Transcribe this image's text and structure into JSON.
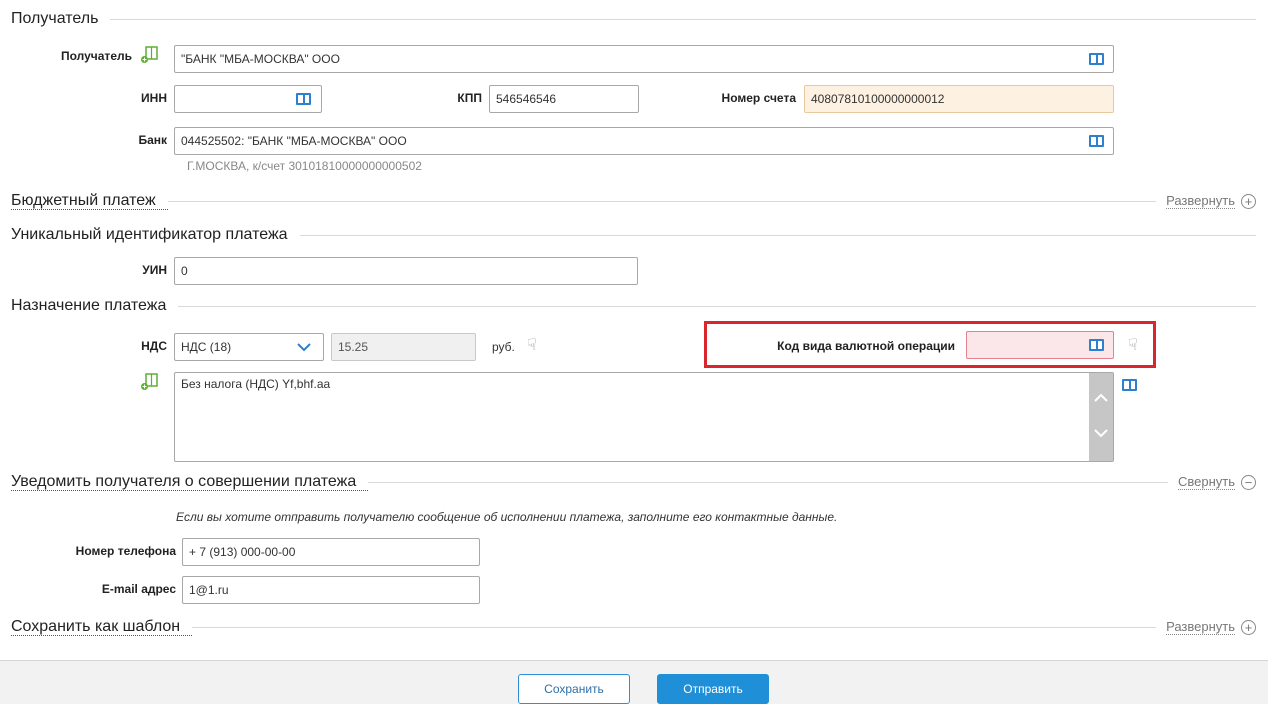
{
  "colors": {
    "accent": "#1f8fd8",
    "highlight_box": "#d9262c",
    "account_field_bg": "#fdf1e2",
    "error_field_bg": "#fbe6ea",
    "contact_icon": "#5cb030"
  },
  "sections": {
    "recipient": {
      "title": "Получатель",
      "recipient_label": "Получатель",
      "recipient_value": "\"БАНК \"МБА-МОСКВА\" ООО",
      "inn_label": "ИНН",
      "inn_value": "",
      "kpp_label": "КПП",
      "kpp_value": "546546546",
      "account_label": "Номер счета",
      "account_value": "40807810100000000012",
      "bank_label": "Банк",
      "bank_value": "044525502: \"БАНК \"МБА-МОСКВА\" ООО",
      "bank_note": "Г.МОСКВА, к/счет 30101810000000000502"
    },
    "budget": {
      "title": "Бюджетный платеж",
      "toggle": "Развернуть"
    },
    "uin": {
      "title": "Уникальный идентификатор платежа",
      "label": "УИН",
      "value": "0"
    },
    "purpose": {
      "title": "Назначение платежа",
      "vat_label": "НДС",
      "vat_selected": "НДС (18)",
      "vat_amount": "15.25",
      "currency": "руб.",
      "currency_op_label": "Код вида валютной операции",
      "currency_op_value": "",
      "purpose_text": "Без налога (НДС) Yf,bhf.aa"
    },
    "notify": {
      "title": "Уведомить получателя о совершении платежа",
      "toggle": "Свернуть",
      "hint": "Если вы хотите отправить получателю сообщение об исполнении платежа, заполните его контактные данные.",
      "phone_label": "Номер телефона",
      "phone_value": "+ 7 (913) 000-00-00",
      "email_label": "E-mail адрес",
      "email_value": "1@1.ru"
    },
    "template": {
      "title": "Сохранить как шаблон",
      "toggle": "Развернуть"
    }
  },
  "buttons": {
    "save": "Сохранить",
    "send": "Отправить"
  },
  "icons": {
    "contact": "contact-book-icon",
    "directory": "directory-book-icon",
    "hand": "pointing-hand-icon",
    "dropdown": "chevron-down-icon"
  }
}
